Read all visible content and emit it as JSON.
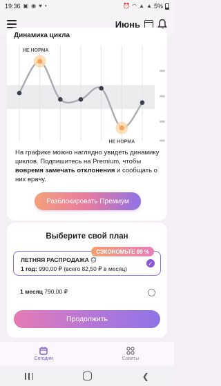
{
  "status_bar": {
    "time": "19:36",
    "battery": "5%"
  },
  "header": {
    "month": "Июнь"
  },
  "cycle_card": {
    "title": "Динамика цикла",
    "marker_high": "НЕ НОРМА",
    "marker_low": "НЕ НОРМА",
    "description_1": "На графике можно наглядно увидеть динамику циклов. Подпишитесь на Premium, чтобы ",
    "description_bold": "вовремя замечать отклонения",
    "description_2": " и сообщать о них врачу.",
    "unlock_label": "Разблокировать Премиум"
  },
  "plan_card": {
    "title": "Выберите свой план",
    "save_badge": "СЭКОНОМЬТЕ 89 %",
    "plan1_name": "ЛЕТНЯЯ РАСПРОДАЖА 😊",
    "plan1_price_bold": "1 год:",
    "plan1_price": " 990,00 ₽ (всего 82,50 ₽ в месяц)",
    "plan2_bold": "1 месяц",
    "plan2_price": " 790,00 ₽",
    "continue_label": "Продолжить"
  },
  "bottom_nav": {
    "today_label": "Сегодня",
    "tips_label": "Советы"
  },
  "colors": {
    "accent": "#8a55d4",
    "orange": "#f4a35c",
    "chart_line": "#a9a9b1",
    "chart_dot": "#3a3f4c"
  },
  "chart_data": {
    "type": "line",
    "series": [
      {
        "values": [
          2,
          4,
          1.6,
          1.6,
          2.3,
          -0.2,
          1.4
        ]
      }
    ],
    "highlight": [
      {
        "index": 1,
        "label": "НЕ НОРМА"
      },
      {
        "index": 5,
        "label": "НЕ НОРМА"
      }
    ],
    "ylim": [
      -1,
      5
    ],
    "grid": true
  }
}
